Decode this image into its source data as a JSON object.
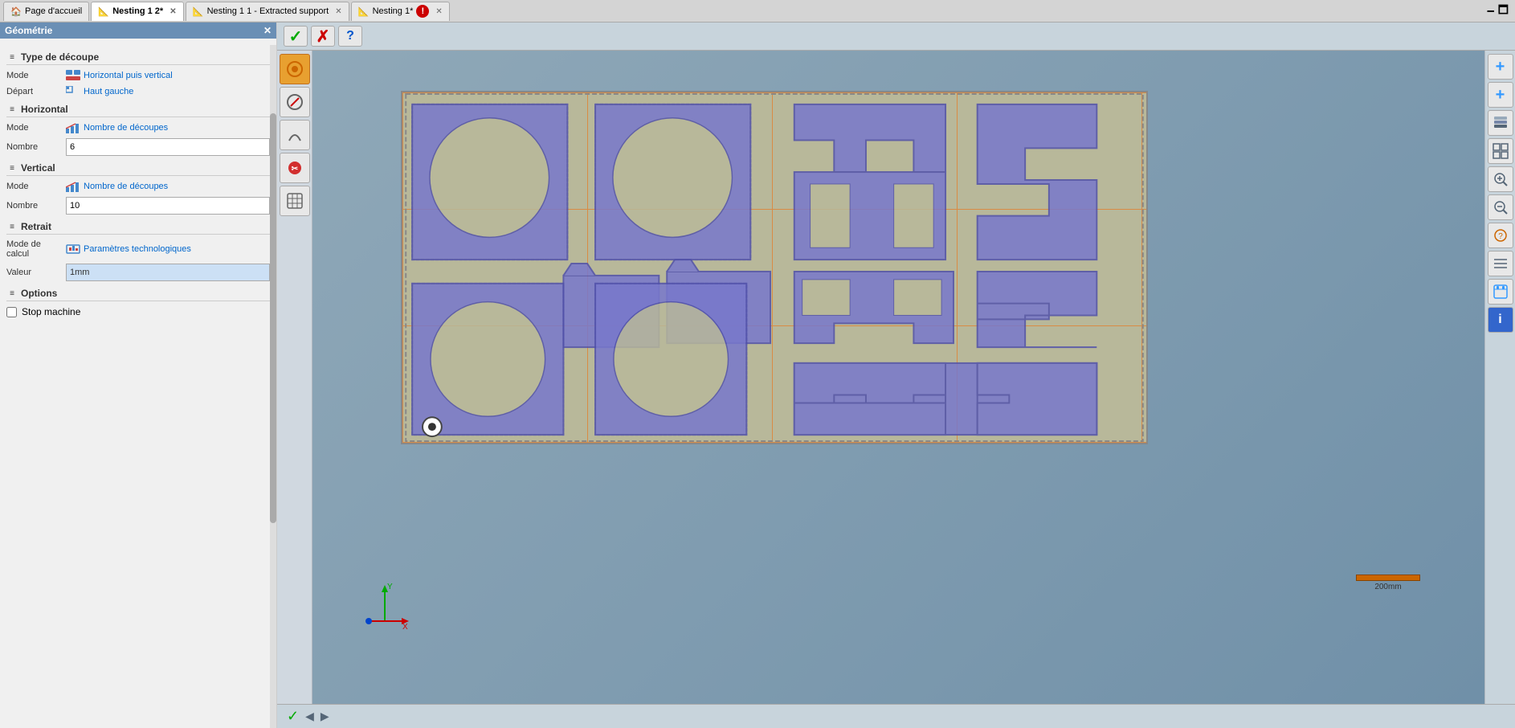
{
  "window_title": "Géométrie",
  "tabs": [
    {
      "label": "Page d'accueil",
      "icon": "home",
      "active": false,
      "closable": false
    },
    {
      "label": "Nesting 1 2*",
      "icon": "nesting",
      "active": true,
      "closable": true
    },
    {
      "label": "Nesting 1 1 - Extracted support",
      "icon": "nesting",
      "active": false,
      "closable": true
    },
    {
      "label": "Nesting 1*",
      "icon": "nesting",
      "active": false,
      "closable": true
    }
  ],
  "left_panel": {
    "title": "Géométrie",
    "sections": [
      {
        "id": "type_decoupe",
        "label": "Type de découpe",
        "fields": [
          {
            "label": "Mode",
            "type": "link",
            "link_label": "Horizontal puis vertical"
          },
          {
            "label": "Départ",
            "type": "link",
            "link_label": "Haut gauche"
          }
        ]
      },
      {
        "id": "horizontal",
        "label": "Horizontal",
        "fields": [
          {
            "label": "Mode",
            "type": "link",
            "link_label": "Nombre de découpes"
          },
          {
            "label": "Nombre",
            "type": "input",
            "value": "6"
          }
        ]
      },
      {
        "id": "vertical",
        "label": "Vertical",
        "fields": [
          {
            "label": "Mode",
            "type": "link",
            "link_label": "Nombre de découpes"
          },
          {
            "label": "Nombre",
            "type": "input",
            "value": "10"
          }
        ]
      },
      {
        "id": "retrait",
        "label": "Retrait",
        "fields": [
          {
            "label": "Mode de calcul",
            "type": "link",
            "link_label": "Paramètres technologiques"
          },
          {
            "label": "Valeur",
            "type": "text_input",
            "value": "1mm",
            "placeholder": "1mm"
          }
        ]
      },
      {
        "id": "options",
        "label": "Options",
        "fields": [
          {
            "label": "Stop machine",
            "type": "checkbox",
            "checked": false
          }
        ]
      }
    ]
  },
  "toolbar": {
    "confirm_label": "✓",
    "cancel_label": "✗",
    "help_label": "?"
  },
  "canvas": {
    "scale_label": "200mm",
    "background_color": "#b8b89a"
  },
  "right_sidebar_buttons": [
    "plus-large",
    "plus-small",
    "layers",
    "grid",
    "search-plus",
    "search-minus",
    "pan",
    "question",
    "list",
    "settings",
    "info"
  ],
  "status_bar": {
    "check_icon": "✓",
    "nav_prev": "◀",
    "nav_next": "▶"
  }
}
